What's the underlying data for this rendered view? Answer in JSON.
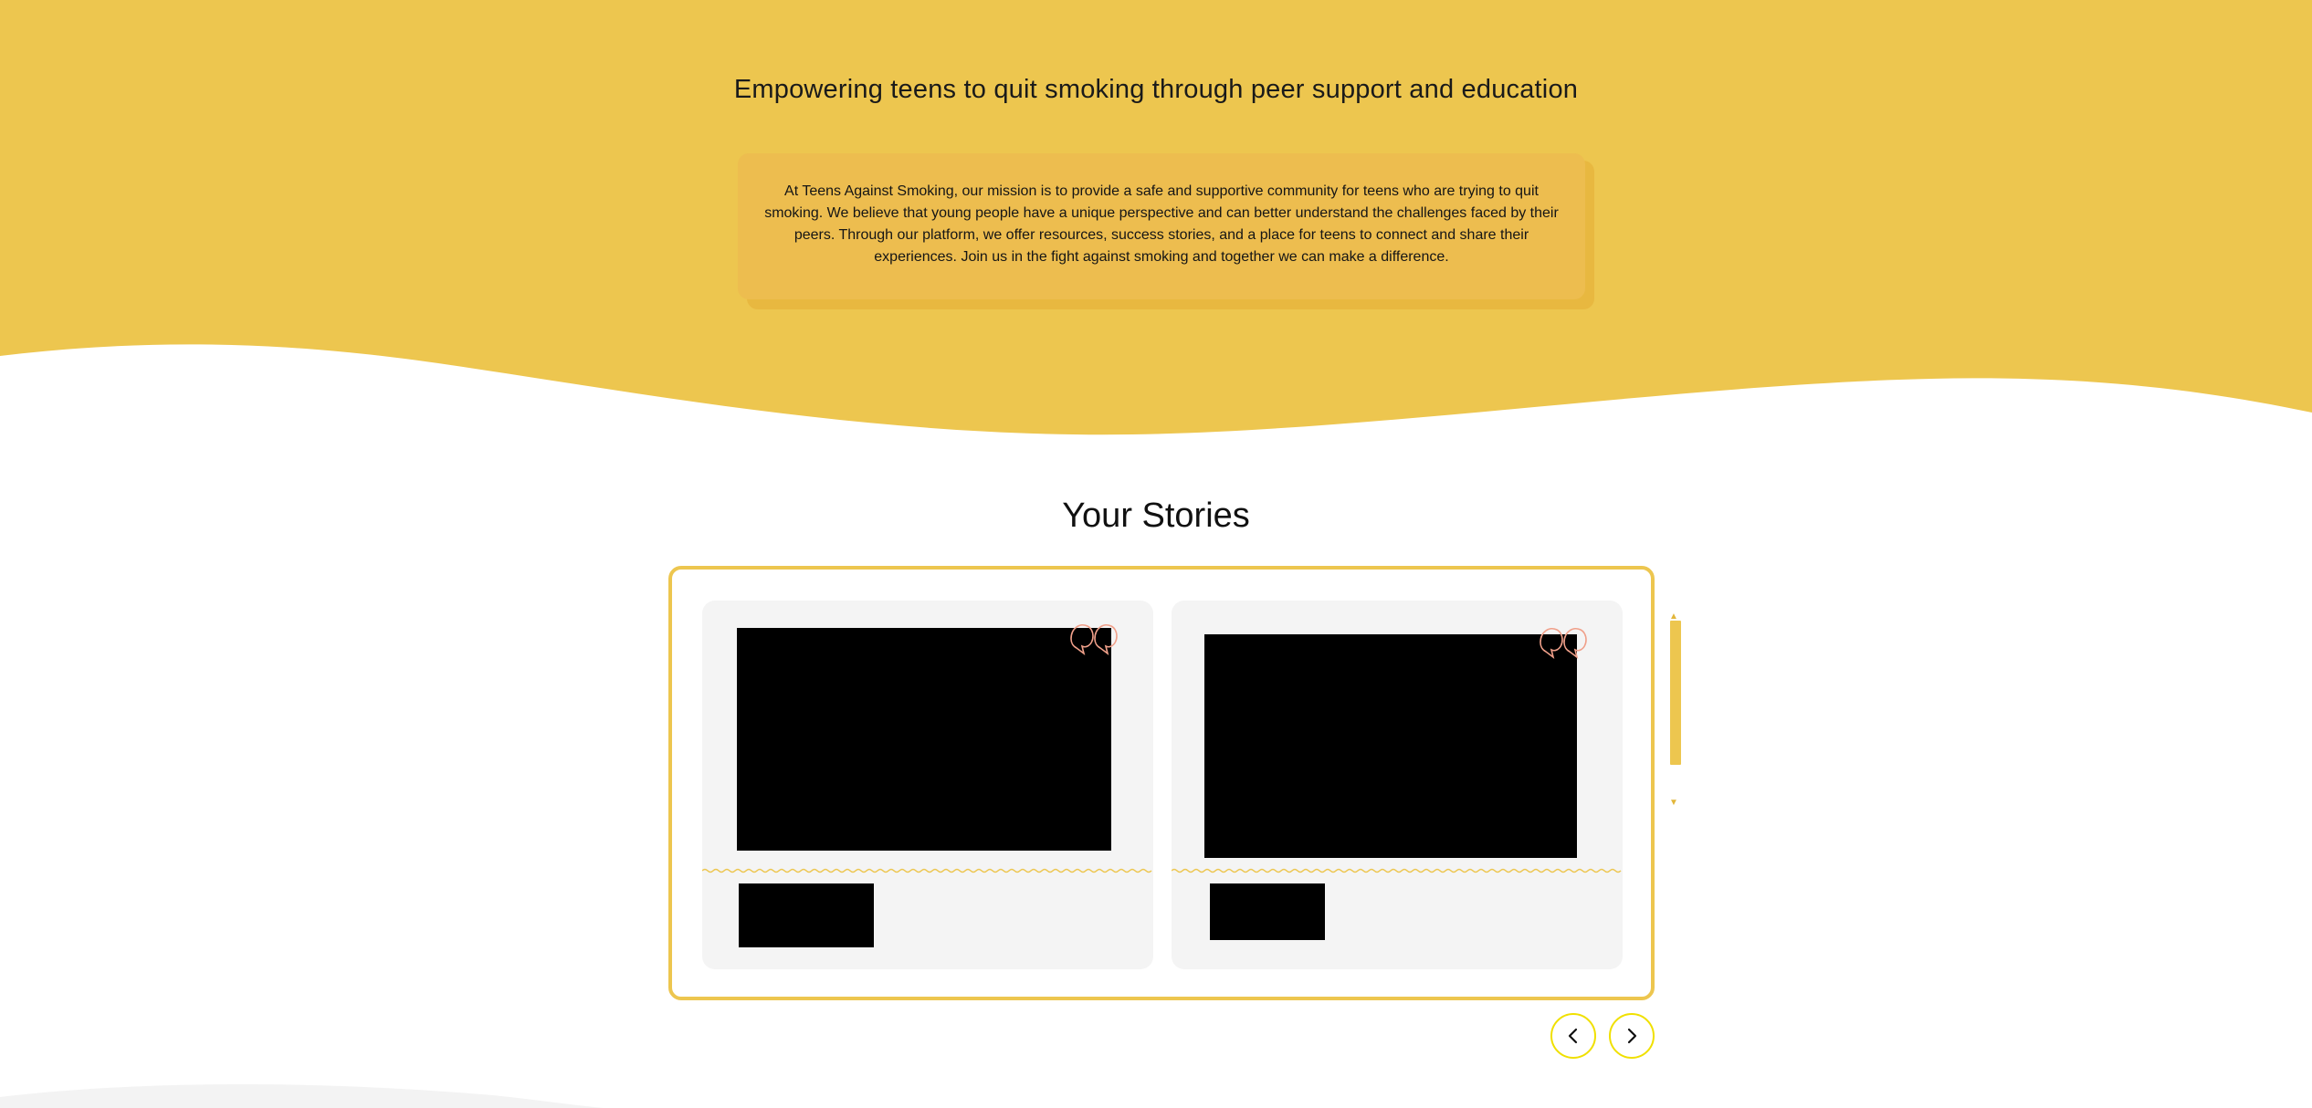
{
  "hero": {
    "headline": "Empowering teens to quit smoking through peer support and education",
    "mission_text": "At Teens Against Smoking, our mission is to provide a safe and supportive community for teens who are trying to quit smoking. We believe that young people have a unique perspective and can better understand the challenges faced by their peers. Through our platform, we offer resources, success stories, and a place for teens to connect and share their experiences. Join us in the fight against smoking and together we can make a difference."
  },
  "stories": {
    "title": "Your Stories",
    "cards": [
      {
        "media": "redacted-image",
        "name": "redacted"
      },
      {
        "media": "redacted-image",
        "name": "redacted"
      }
    ],
    "nav": {
      "prev_icon": "chevron-left-icon",
      "next_icon": "chevron-right-icon"
    }
  },
  "colors": {
    "brand_yellow": "#edc64f",
    "mission_box": "#edbd4f",
    "card_bg": "#f4f4f4",
    "quote_accent": "#f0a08a",
    "nav_ring": "#f0e000"
  }
}
